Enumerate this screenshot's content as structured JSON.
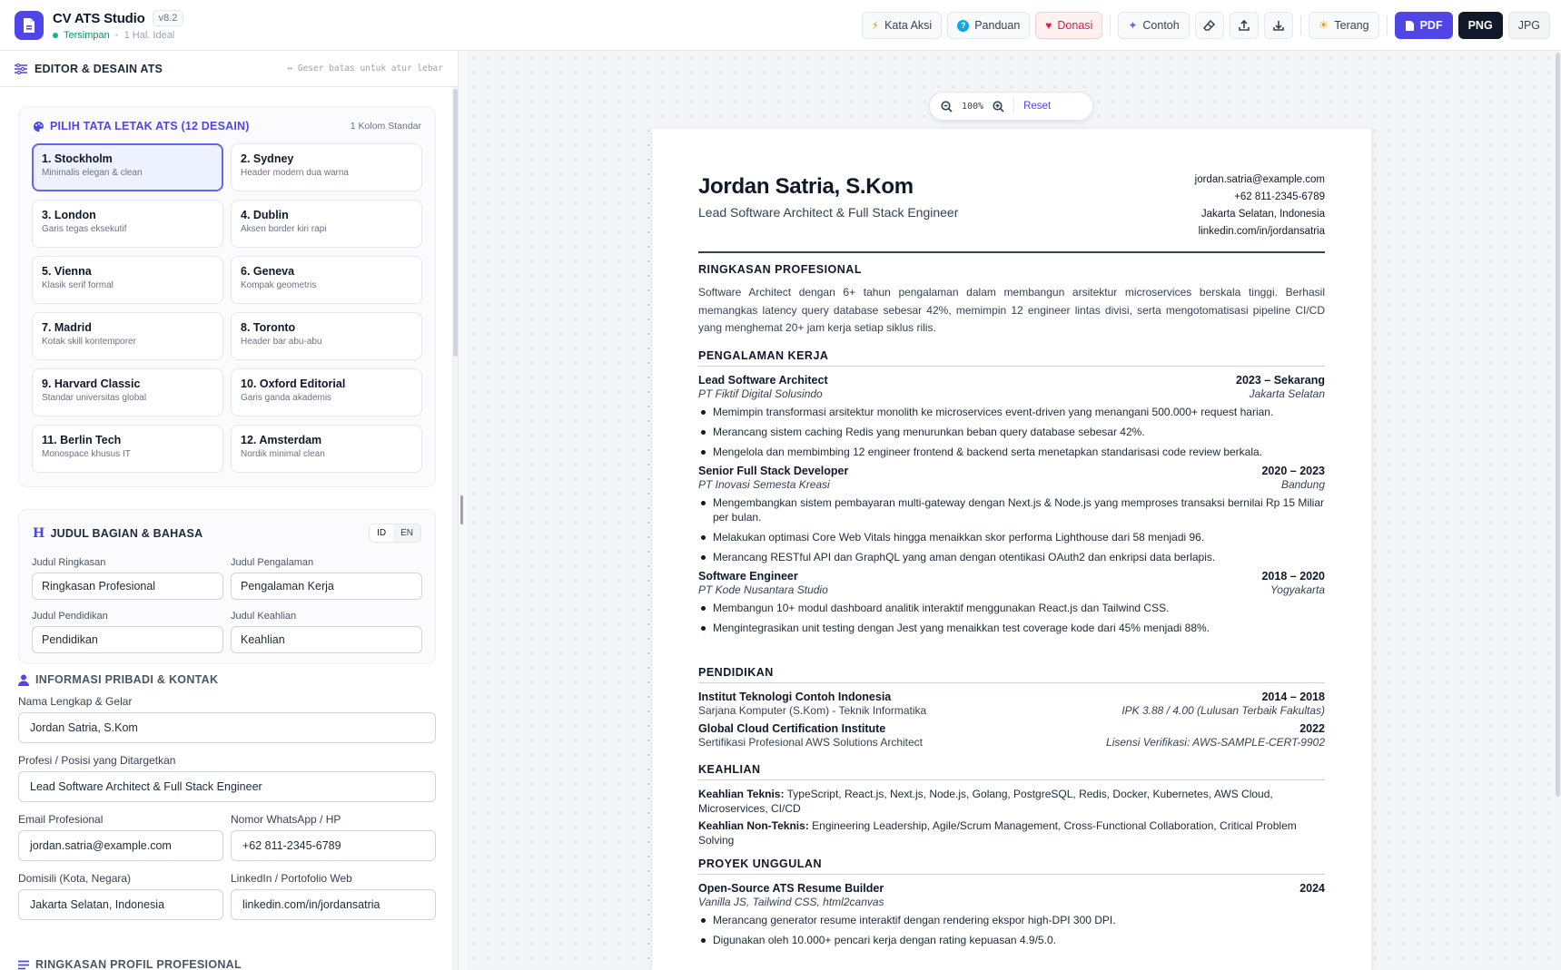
{
  "app": {
    "title": "CV ATS Studio",
    "version": "v8.2",
    "status": "Tersimpan",
    "page_note": "1 Hal. Ideal"
  },
  "toolbar": {
    "kata_aksi": "Kata Aksi",
    "panduan": "Panduan",
    "donasi": "Donasi",
    "contoh": "Contoh",
    "theme": "Terang",
    "pdf": "PDF",
    "png": "PNG",
    "jpg": "JPG"
  },
  "editor": {
    "title": "EDITOR & DESAIN ATS",
    "hint": "↔ Geser batas untuk atur lebar"
  },
  "layouts": {
    "title": "PILIH TATA LETAK ATS (12 DESAIN)",
    "meta": "1 Kolom Standar",
    "items": [
      {
        "name": "1. Stockholm",
        "desc": "Minimalis elegan & clean"
      },
      {
        "name": "2. Sydney",
        "desc": "Header modern dua warna"
      },
      {
        "name": "3. London",
        "desc": "Garis tegas eksekutif"
      },
      {
        "name": "4. Dublin",
        "desc": "Aksen border kiri rapi"
      },
      {
        "name": "5. Vienna",
        "desc": "Klasik serif formal"
      },
      {
        "name": "6. Geneva",
        "desc": "Kompak geometris"
      },
      {
        "name": "7. Madrid",
        "desc": "Kotak skill kontemporer"
      },
      {
        "name": "8. Toronto",
        "desc": "Header bar abu-abu"
      },
      {
        "name": "9. Harvard Classic",
        "desc": "Standar universitas global"
      },
      {
        "name": "10. Oxford Editorial",
        "desc": "Garis ganda akademis"
      },
      {
        "name": "11. Berlin Tech",
        "desc": "Monospace khusus IT"
      },
      {
        "name": "12. Amsterdam",
        "desc": "Nordik minimal clean"
      }
    ]
  },
  "sections": {
    "title": "JUDUL BAGIAN & BAHASA",
    "lang_id": "ID",
    "lang_en": "EN",
    "summary_label": "Judul Ringkasan",
    "summary_value": "Ringkasan Profesional",
    "experience_label": "Judul Pengalaman",
    "experience_value": "Pengalaman Kerja",
    "education_label": "Judul Pendidikan",
    "education_value": "Pendidikan",
    "skills_label": "Judul Keahlian",
    "skills_value": "Keahlian"
  },
  "personal": {
    "title": "INFORMASI PRIBADI & KONTAK",
    "name_label": "Nama Lengkap & Gelar",
    "name_value": "Jordan Satria, S.Kom",
    "role_label": "Profesi / Posisi yang Ditargetkan",
    "role_value": "Lead Software Architect & Full Stack Engineer",
    "email_label": "Email Profesional",
    "email_value": "jordan.satria@example.com",
    "phone_label": "Nomor WhatsApp / HP",
    "phone_value": "+62 811-2345-6789",
    "city_label": "Domisili (Kota, Negara)",
    "city_value": "Jakarta Selatan, Indonesia",
    "linkedin_label": "LinkedIn / Portofolio Web",
    "linkedin_value": "linkedin.com/in/jordansatria"
  },
  "summary_section": {
    "title": "RINGKASAN PROFIL PROFESIONAL"
  },
  "zoom": {
    "value": "100%",
    "reset": "Reset"
  },
  "cv": {
    "name": "Jordan Satria, S.Kom",
    "role": "Lead Software Architect & Full Stack Engineer",
    "email": "jordan.satria@example.com",
    "phone": "+62 811-2345-6789",
    "location": "Jakarta Selatan, Indonesia",
    "linkedin": "linkedin.com/in/jordansatria",
    "summary_title": "RINGKASAN PROFESIONAL",
    "summary": "Software Architect dengan 6+ tahun pengalaman dalam membangun arsitektur microservices berskala tinggi. Berhasil memangkas latency query database sebesar 42%, memimpin 12 engineer lintas divisi, serta mengotomatisasi pipeline CI/CD yang menghemat 20+ jam kerja setiap siklus rilis.",
    "experience_title": "PENGALAMAN KERJA",
    "jobs": [
      {
        "title": "Lead Software Architect",
        "period": "2023 – Sekarang",
        "company": "PT Fiktif Digital Solusindo",
        "location": "Jakarta Selatan",
        "bullets": [
          "Memimpin transformasi arsitektur monolith ke microservices event-driven yang menangani 500.000+ request harian.",
          "Merancang sistem caching Redis yang menurunkan beban query database sebesar 42%.",
          "Mengelola dan membimbing 12 engineer frontend & backend serta menetapkan standarisasi code review berkala."
        ]
      },
      {
        "title": "Senior Full Stack Developer",
        "period": "2020 – 2023",
        "company": "PT Inovasi Semesta Kreasi",
        "location": "Bandung",
        "bullets": [
          "Mengembangkan sistem pembayaran multi-gateway dengan Next.js & Node.js yang memproses transaksi bernilai Rp 15 Miliar per bulan.",
          "Melakukan optimasi Core Web Vitals hingga menaikkan skor performa Lighthouse dari 58 menjadi 96.",
          "Merancang RESTful API dan GraphQL yang aman dengan otentikasi OAuth2 dan enkripsi data berlapis."
        ]
      },
      {
        "title": "Software Engineer",
        "period": "2018 – 2020",
        "company": "PT Kode Nusantara Studio",
        "location": "Yogyakarta",
        "bullets": [
          "Membangun 10+ modul dashboard analitik interaktif menggunakan React.js dan Tailwind CSS.",
          "Mengintegrasikan unit testing dengan Jest yang menaikkan test coverage kode dari 45% menjadi 88%."
        ]
      }
    ],
    "education_title": "PENDIDIKAN",
    "education": [
      {
        "school": "Institut Teknologi Contoh Indonesia",
        "period": "2014 – 2018",
        "degree": "Sarjana Komputer (S.Kom) - Teknik Informatika",
        "note": "IPK 3.88 / 4.00 (Lulusan Terbaik Fakultas)"
      },
      {
        "school": "Global Cloud Certification Institute",
        "period": "2022",
        "degree": "Sertifikasi Profesional AWS Solutions Architect",
        "note": "Lisensi Verifikasi: AWS-SAMPLE-CERT-9902"
      }
    ],
    "skills_title": "KEAHLIAN",
    "skills_tech_label": "Keahlian Teknis:",
    "skills_tech": "TypeScript, React.js, Next.js, Node.js, Golang, PostgreSQL, Redis, Docker, Kubernetes, AWS Cloud, Microservices, CI/CD",
    "skills_soft_label": "Keahlian Non-Teknis:",
    "skills_soft": "Engineering Leadership, Agile/Scrum Management, Cross-Functional Collaboration, Critical Problem Solving",
    "projects_title": "PROYEK UNGGULAN",
    "project": {
      "title": "Open-Source ATS Resume Builder",
      "year": "2024",
      "stack": "Vanilla JS, Tailwind CSS, html2canvas",
      "bullets": [
        "Merancang generator resume interaktif dengan rendering ekspor high-DPI 300 DPI.",
        "Digunakan oleh 10.000+ pencari kerja dengan rating kepuasan 4.9/5.0."
      ]
    }
  }
}
